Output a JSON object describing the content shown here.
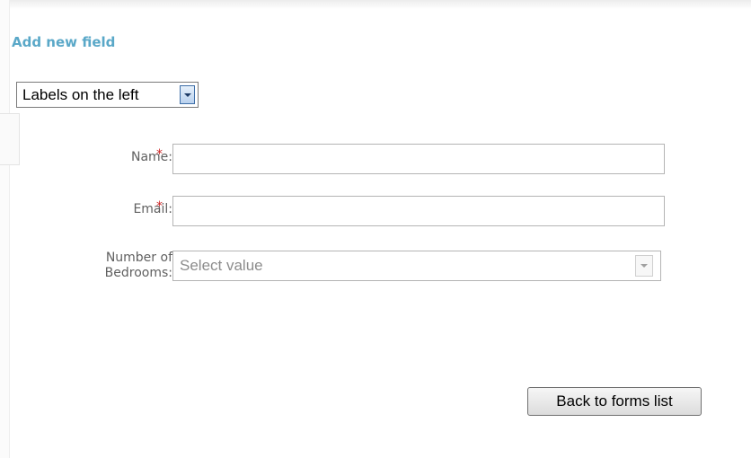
{
  "header": {
    "add_field_link": "Add new field"
  },
  "label_position_select": {
    "selected": "Labels on the left"
  },
  "form": {
    "fields": [
      {
        "label": "Name:",
        "required_mark": "*",
        "value": ""
      },
      {
        "label": "Email:",
        "required_mark": "*",
        "value": ""
      },
      {
        "label_line1": "Number of",
        "label_line2": "Bedrooms:",
        "placeholder": "Select value"
      }
    ]
  },
  "footer": {
    "back_button_label": "Back to forms list"
  },
  "colors": {
    "link": "#5aa8c8",
    "required": "#cc2222",
    "label": "#606060"
  },
  "icons": {
    "dropdown": "chevron-down-icon"
  }
}
